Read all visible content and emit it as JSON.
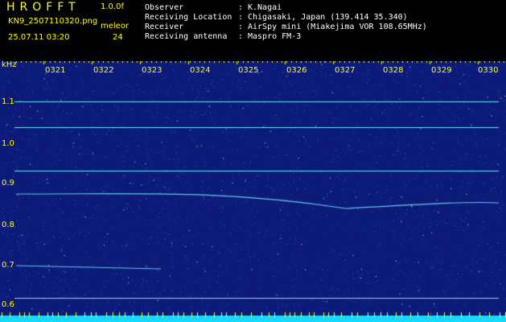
{
  "header": {
    "app_title": "HROFFT",
    "version": "1.0.0f",
    "filename": "KN9_2507110320.png",
    "mode_label": "meleor",
    "datetime": "25.07.11 03:20",
    "mode_value": "24",
    "info": [
      {
        "label": "Observer",
        "value": "K.Nagai"
      },
      {
        "label": "Receiving Location",
        "value": "Chigasaki, Japan (139.414 35.340)"
      },
      {
        "label": "Receiver",
        "value": "AirSpy mini (Miakejima VOR 108.65MHz)"
      },
      {
        "label": "Receiving antenna",
        "value": "Maspro FM-3"
      }
    ],
    "colon": ":"
  },
  "spectrogram": {
    "y_unit": "kHz",
    "y_ticks": [
      "1.1",
      "1.0",
      "0.9",
      "0.8",
      "0.7",
      "0.6"
    ],
    "time_ticks": [
      "0321",
      "0322",
      "0323",
      "0324",
      "0325",
      "0326",
      "0327",
      "0328",
      "0329",
      "0330"
    ],
    "colors": {
      "background": "#0c1a78",
      "axis_text": "#ffff00",
      "trace": "#6ee6ff",
      "bottom_band": "#18d8ff"
    }
  }
}
